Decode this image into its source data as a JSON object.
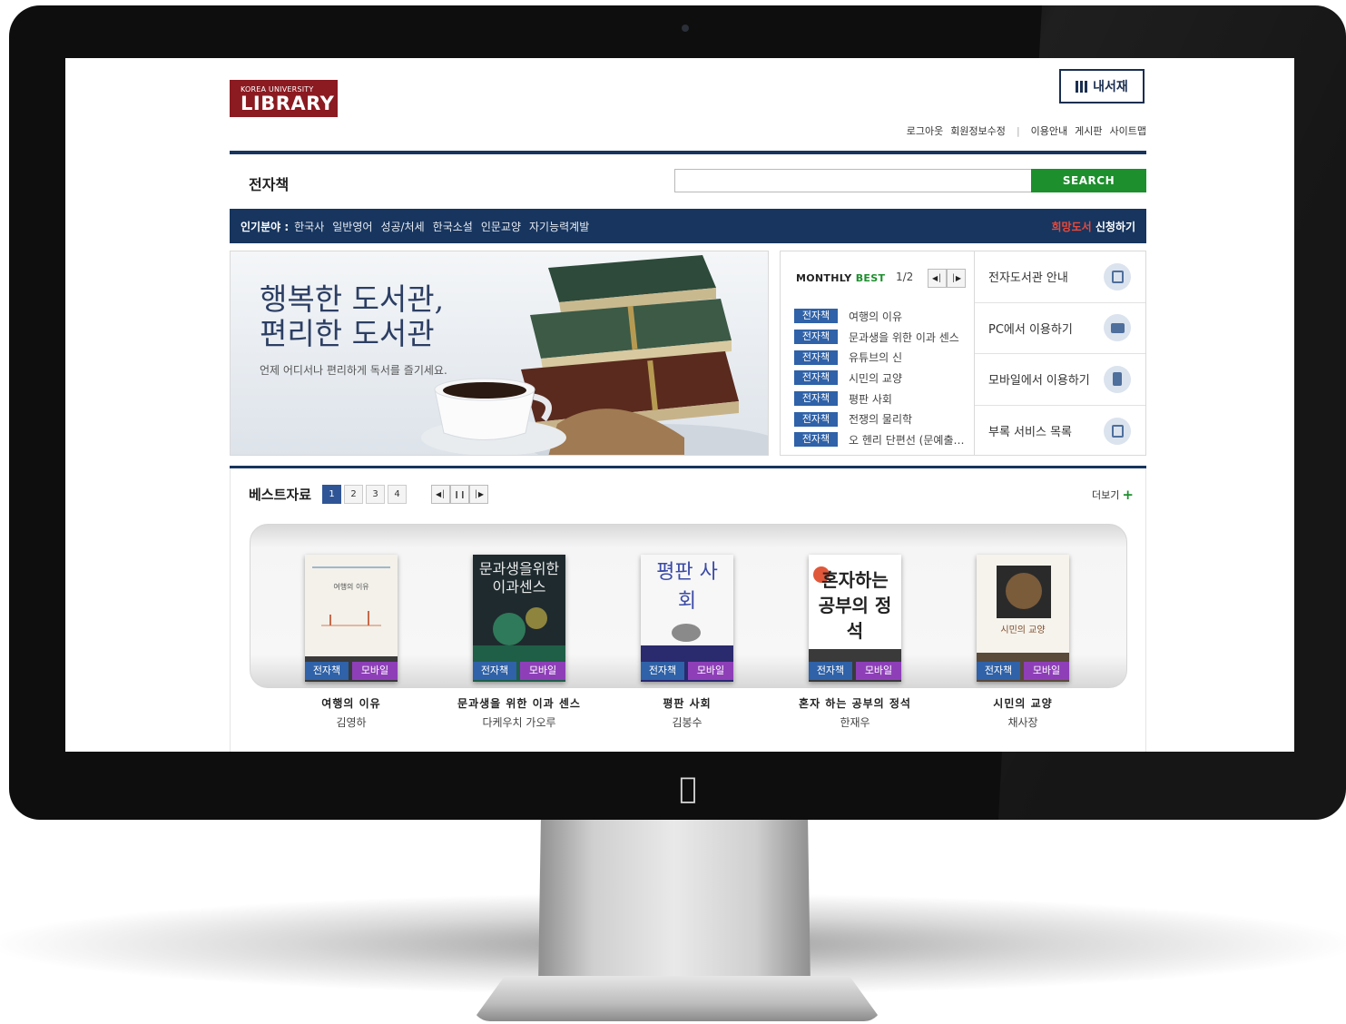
{
  "header": {
    "logo_line1": "KOREA UNIVERSITY",
    "logo_line2": "LIBRARY",
    "my_library": "내서재",
    "util_links": [
      "로그아웃",
      "회원정보수정",
      "이용안내",
      "게시판",
      "사이트맵"
    ]
  },
  "search": {
    "page_title": "전자책",
    "placeholder": "",
    "button": "SEARCH"
  },
  "popular": {
    "label": "인기분야 :",
    "items": [
      "한국사",
      "일반영어",
      "성공/처세",
      "한국소설",
      "인문교양",
      "자기능력계발"
    ],
    "request_highlight": "희망도서",
    "request_rest": " 신청하기"
  },
  "banner": {
    "title_line1": "행복한 도서관,",
    "title_line2": "편리한 도서관",
    "subtitle": "언제 어디서나 편리하게 독서를 즐기세요."
  },
  "monthly_best": {
    "label_a": "MONTHLY ",
    "label_b": "BEST",
    "page": "1/2",
    "tag": "전자책",
    "items": [
      "여행의 이유",
      "문과생을 위한 이과 센스",
      "유튜브의 신",
      "시민의 교양",
      "평판 사회",
      "전쟁의 물리학",
      "오 헨리 단편선 (문예출판사)"
    ]
  },
  "guide": {
    "items": [
      "전자도서관 안내",
      "PC에서 이용하기",
      "모바일에서 이용하기",
      "부록 서비스 목록"
    ]
  },
  "best_section": {
    "title": "베스트자료",
    "pages": [
      "1",
      "2",
      "3",
      "4"
    ],
    "more": "더보기",
    "tag_ebook": "전자책",
    "tag_mobile": "모바일",
    "books": [
      {
        "title": "여행의 이유",
        "author": "김영하",
        "cover": "여행의 이유"
      },
      {
        "title": "문과생을 위한 이과 센스",
        "author": "다케우치 가오루",
        "cover": "문과생을위한 이과센스"
      },
      {
        "title": "평판 사회",
        "author": "김봉수",
        "cover": "평판 사회"
      },
      {
        "title": "혼자 하는 공부의 정석",
        "author": "한재우",
        "cover": "혼자하는 공부의 정석"
      },
      {
        "title": "시민의 교양",
        "author": "채사장",
        "cover": "시민의 교양"
      }
    ]
  }
}
